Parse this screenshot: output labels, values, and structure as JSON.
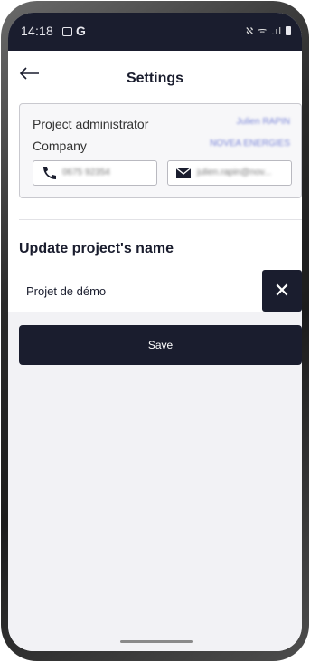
{
  "status_bar": {
    "time": "14:18",
    "app_glyph": "G",
    "right_icons": "ℵ ᯤ .ıl"
  },
  "header": {
    "title": "Settings",
    "back_icon": "arrow-left-icon"
  },
  "project_card": {
    "administrator_label": "Project administrator",
    "administrator_value": "Julien RAPIN",
    "company_label": "Company",
    "company_value": "NOVEA ENERGIES",
    "phone_icon": "phone-icon",
    "phone_value": "0675 92354",
    "email_icon": "mail-icon",
    "email_value": "julien.rapin@nov..."
  },
  "rename_section": {
    "title": "Update project's name",
    "input_value": "Projet de démo",
    "clear_icon": "close-icon",
    "clear_glyph": "✕",
    "save_label": "Save"
  },
  "colors": {
    "primary": "#1a1d2e",
    "link_value": "#7b86d8",
    "card_bg": "#f7f7f9",
    "page_bg": "#f2f2f5"
  }
}
